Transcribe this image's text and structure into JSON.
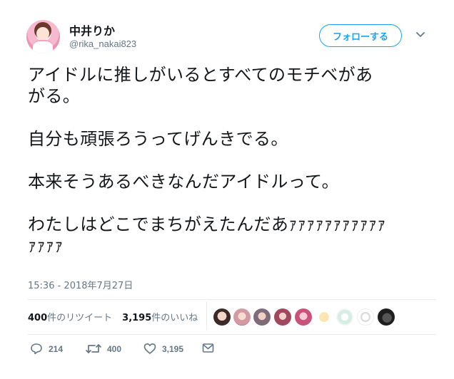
{
  "user": {
    "name": "中井りか",
    "handle": "@rika_nakai823"
  },
  "follow_button_label": "フォローする",
  "tweet": {
    "lines": [
      "アイドルに推しがいるとすべてのモチベがあ",
      "がる。",
      "自分も頑張ろうってげんきでる。",
      "本来そうあるべきなんだアイドルって。",
      "わたしはどこでまちがえたんだあｧｧｧｧｧｧｧｧｧｧｧ",
      "ｧｧｧｧ"
    ],
    "timestamp": "15:36 - 2018年7月27日"
  },
  "stats": {
    "retweets_count": "400",
    "retweets_label": "件のリツイート",
    "likes_count": "3,195",
    "likes_label": "件のいいね"
  },
  "actions": {
    "reply_count": "214",
    "retweet_count": "400",
    "like_count": "3,195"
  },
  "colors": {
    "accent": "#1da1f2",
    "text": "#14171a",
    "secondary": "#657786",
    "divider": "#e6ecf0"
  },
  "icons": [
    "reply-icon",
    "retweet-icon",
    "like-icon",
    "message-icon",
    "chevron-down-icon"
  ]
}
